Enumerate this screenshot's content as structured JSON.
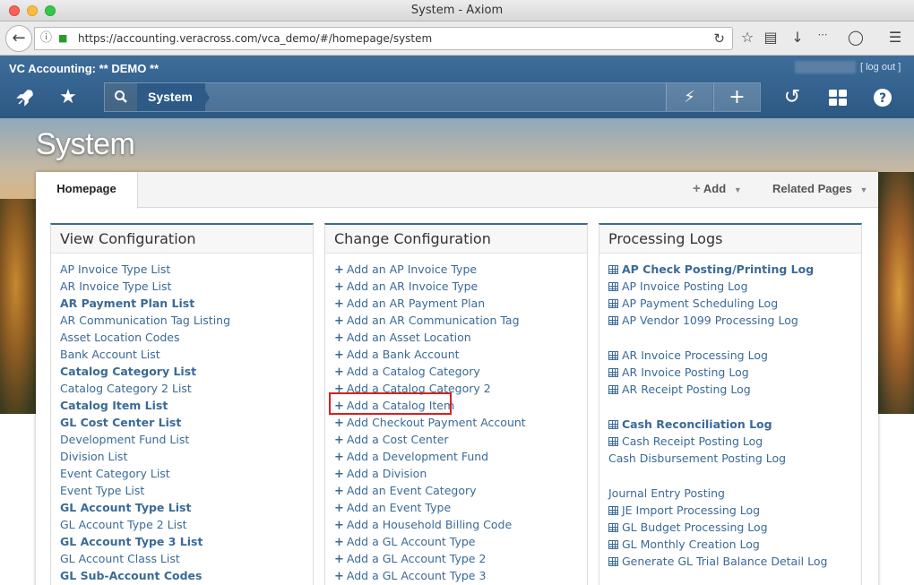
{
  "window": {
    "title": "System - Axiom"
  },
  "browser": {
    "url": "https://accounting.veracross.com/vca_demo/#/homepage/system"
  },
  "app": {
    "name": "VC Accounting: ** DEMO **",
    "logout_label": "[ log out ]",
    "breadcrumb": "System"
  },
  "page": {
    "title": "System",
    "tab_label": "Homepage",
    "add_label": "Add",
    "related_label": "Related Pages"
  },
  "view_configuration": {
    "title": "View Configuration",
    "items": [
      "AP Invoice Type List",
      "AR Invoice Type List",
      "AR Payment Plan List",
      "AR Communication Tag Listing",
      "Asset Location Codes",
      "Bank Account List",
      "Catalog Category List",
      "Catalog Category 2 List",
      "Catalog Item List",
      "GL Cost Center List",
      "Development Fund List",
      "Division List",
      "Event Category List",
      "Event Type List",
      "GL Account Type List",
      "GL Account Type 2 List",
      "GL Account Type 3 List",
      "GL Account Class List",
      "GL Sub-Account Codes"
    ]
  },
  "change_configuration": {
    "title": "Change Configuration",
    "items": [
      "Add an AP Invoice Type",
      "Add an AR Invoice Type",
      "Add an AR Payment Plan",
      "Add an AR Communication Tag",
      "Add an Asset Location",
      "Add a Bank Account",
      "Add a Catalog Category",
      "Add a Catalog Category 2",
      "Add a Catalog Item",
      "Add Checkout Payment Account",
      "Add a Cost Center",
      "Add a Development Fund",
      "Add a Division",
      "Add an Event Category",
      "Add an Event Type",
      "Add a Household Billing Code",
      "Add a GL Account Type",
      "Add a GL Account Type 2",
      "Add a GL Account Type 3"
    ]
  },
  "processing_logs": {
    "title": "Processing Logs",
    "items": [
      "AP Check Posting/Printing Log",
      "AP Invoice Posting Log",
      "AP Payment Scheduling Log",
      "AP Vendor 1099 Processing Log",
      "AR Invoice Processing Log",
      "AR Invoice Posting Log",
      "AR Receipt Posting Log",
      "Cash Reconciliation Log",
      "Cash Receipt Posting Log",
      "Cash Disbursement Posting Log",
      "Journal Entry Posting",
      "JE Import Processing Log",
      "GL Budget Processing Log",
      "GL Monthly Creation Log",
      "Generate GL Trial Balance Detail Log"
    ]
  },
  "colors": {
    "link": "#3a6a98",
    "header": "#2c5883",
    "highlight": "#d9201e"
  }
}
